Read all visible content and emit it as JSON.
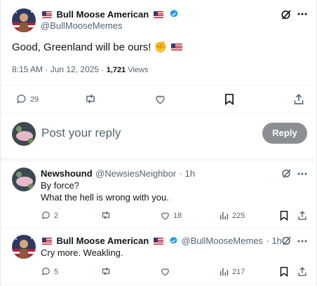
{
  "main_post": {
    "display_name": "Bull Moose American",
    "handle": "@BullMooseMemes",
    "text": "Good, Greenland will be ours! ✊",
    "time": "8:15 AM · Jun 12, 2025 · ",
    "views_count": "1,721",
    "views_label": " Views",
    "reply_count": "29"
  },
  "composer": {
    "placeholder": "Post your reply",
    "reply_button": "Reply"
  },
  "replies": [
    {
      "display_name": "Newshound",
      "handle": "@NewsiesNeighbor",
      "time": "· 1h",
      "lines": [
        "By force?",
        "What the hell is wrong with you."
      ],
      "reply_count": "2",
      "like_count": "18",
      "view_count": "225"
    },
    {
      "display_name": "Bull Moose American",
      "handle": "@BullMooseMemes",
      "time": "· 1h",
      "lines": [
        "Cry more. Weakling."
      ],
      "reply_count": "5",
      "view_count": "217"
    }
  ],
  "icons": {
    "grok": "grok-icon",
    "more": "more-icon",
    "reply": "reply-icon",
    "repost": "repost-icon",
    "like": "like-icon",
    "bookmark": "bookmark-icon",
    "share": "share-icon",
    "views": "views-icon",
    "verified": "verified-badge-icon"
  },
  "colors": {
    "verified_blue": "#1d9bf0",
    "muted": "#536471",
    "reply_button": "#8b8f93"
  }
}
